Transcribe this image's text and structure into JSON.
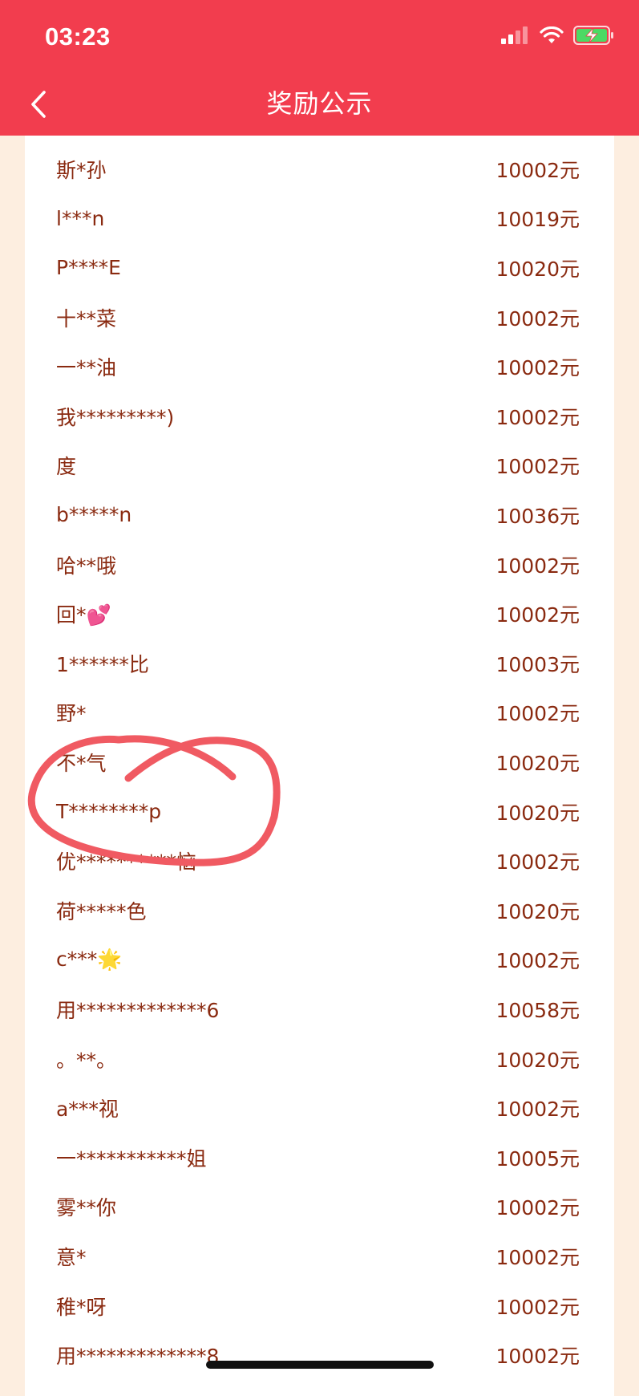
{
  "status_bar": {
    "time": "03:23",
    "icons": [
      "signal-icon",
      "wifi-icon",
      "battery-charging-icon"
    ]
  },
  "header": {
    "title": "奖励公示",
    "back_icon": "chevron-left-icon",
    "background_color": "#f23d4e"
  },
  "theme": {
    "text_color": "#8a2a10",
    "page_background": "#fdeee0",
    "annotation_color": "#f05a62"
  },
  "rewards": [
    {
      "name": "斯*孙",
      "amount": "10002元"
    },
    {
      "name": "l***n",
      "amount": "10019元"
    },
    {
      "name": "P****E",
      "amount": "10020元"
    },
    {
      "name": "十**菜",
      "amount": "10002元"
    },
    {
      "name": "一**油",
      "amount": "10002元"
    },
    {
      "name": "我*********)",
      "amount": "10002元"
    },
    {
      "name": "度",
      "amount": "10002元"
    },
    {
      "name": "b*****n",
      "amount": "10036元"
    },
    {
      "name": "哈**哦",
      "amount": "10002元"
    },
    {
      "name": "回*💕",
      "amount": "10002元"
    },
    {
      "name": "1******比",
      "amount": "10003元"
    },
    {
      "name": "野*",
      "amount": "10002元"
    },
    {
      "name": "不*气",
      "amount": "10020元"
    },
    {
      "name": "T********p",
      "amount": "10020元"
    },
    {
      "name": "优**********恼",
      "amount": "10002元"
    },
    {
      "name": "荷*****色",
      "amount": "10020元"
    },
    {
      "name": "c***🌟",
      "amount": "10002元"
    },
    {
      "name": "用*************6",
      "amount": "10058元"
    },
    {
      "name": "。**。",
      "amount": "10020元"
    },
    {
      "name": "a***视",
      "amount": "10002元"
    },
    {
      "name": "一***********姐",
      "amount": "10005元"
    },
    {
      "name": "雾**你",
      "amount": "10002元"
    },
    {
      "name": "意*",
      "amount": "10002元"
    },
    {
      "name": "稚*呀",
      "amount": "10002元"
    },
    {
      "name": "用*************8",
      "amount": "10002元"
    }
  ]
}
